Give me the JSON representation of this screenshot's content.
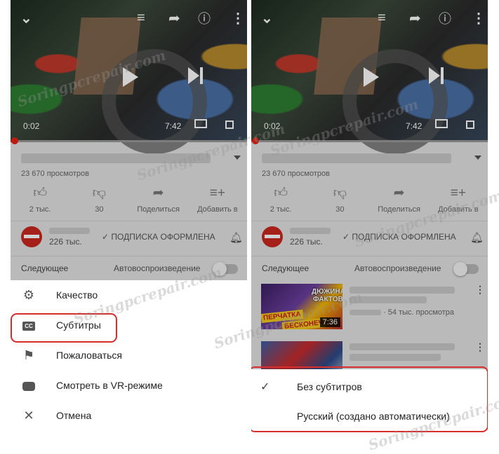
{
  "watermark": "Soringpcrepair.com",
  "left": {
    "player": {
      "current_time": "0:02",
      "total_time": "7:42",
      "progress": 0.005
    },
    "views": "23 670 просмотров",
    "actions": [
      {
        "icon": "thumb-up-icon",
        "label": "2 тыс."
      },
      {
        "icon": "thumb-down-icon",
        "label": "30"
      },
      {
        "icon": "share-icon",
        "label": "Поделиться"
      },
      {
        "icon": "playlist-add-icon",
        "label": "Добавить в"
      }
    ],
    "channel": {
      "subscribers": "226 тыс.",
      "subscribe_status": "ПОДПИСКА ОФОРМЛЕНА"
    },
    "next_label": "Следующее",
    "autoplay_label": "Автовоспроизведение",
    "menu": [
      {
        "icon": "gear-icon",
        "label": "Качество"
      },
      {
        "icon": "closed-captions-icon",
        "label": "Субтитры"
      },
      {
        "icon": "flag-icon",
        "label": "Пожаловаться"
      },
      {
        "icon": "vr-headset-icon",
        "label": "Смотреть в VR-режиме"
      },
      {
        "icon": "close-icon",
        "label": "Отмена"
      }
    ]
  },
  "right": {
    "player": {
      "current_time": "0:02",
      "total_time": "7:42",
      "progress": 0.005
    },
    "views": "23 670 просмотров",
    "actions": [
      {
        "icon": "thumb-up-icon",
        "label": "2 тыс."
      },
      {
        "icon": "thumb-down-icon",
        "label": "30"
      },
      {
        "icon": "share-icon",
        "label": "Поделиться"
      },
      {
        "icon": "playlist-add-icon",
        "label": "Добавить в"
      }
    ],
    "channel": {
      "subscribers": "226 тыс.",
      "subscribe_status": "ПОДПИСКА ОФОРМЛЕНА"
    },
    "next_label": "Следующее",
    "autoplay_label": "Автовоспроизведение",
    "recommendations": [
      {
        "thumb_text_1": "ДЮЖИНА",
        "thumb_text_2": "ФАКТОВ",
        "thumb_banner_1": "ПЕРЧАТКА",
        "thumb_banner_2": "БЕСКОНЕЧ",
        "duration": "7:36",
        "views": "· 54 тыс. просмотра"
      }
    ],
    "subtitles": [
      {
        "label": "Без субтитров",
        "selected": true
      },
      {
        "label": "Русский (создано автоматически)",
        "selected": false
      }
    ]
  }
}
